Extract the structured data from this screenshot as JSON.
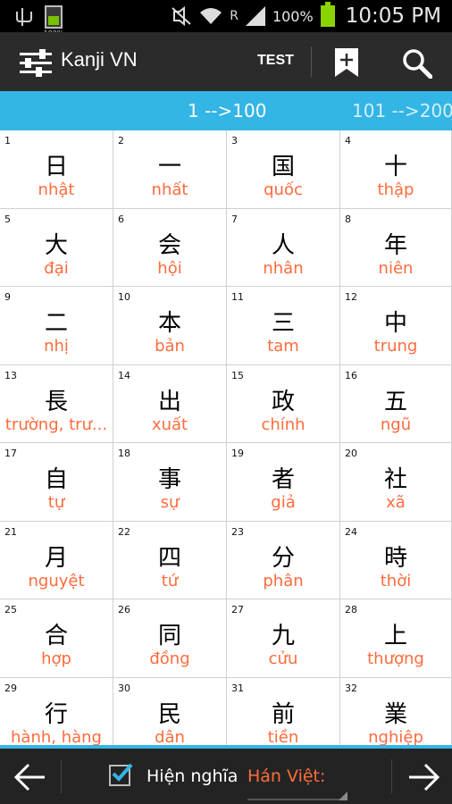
{
  "status_bar": {
    "mini_battery_percent": "100%",
    "roaming": "R",
    "battery_percent": "100%",
    "time": "10:05 PM"
  },
  "action_bar": {
    "title": "Kanji VN",
    "test_label": "TEST"
  },
  "tabs": [
    {
      "label": "1 -->100",
      "selected": true
    },
    {
      "label": "101 -->200",
      "selected": false
    }
  ],
  "kanji": [
    {
      "n": "1",
      "k": "日",
      "r": "nhật"
    },
    {
      "n": "2",
      "k": "一",
      "r": "nhất"
    },
    {
      "n": "3",
      "k": "国",
      "r": "quốc"
    },
    {
      "n": "4",
      "k": "十",
      "r": "thập"
    },
    {
      "n": "5",
      "k": "大",
      "r": "đại"
    },
    {
      "n": "6",
      "k": "会",
      "r": "hội"
    },
    {
      "n": "7",
      "k": "人",
      "r": "nhân"
    },
    {
      "n": "8",
      "k": "年",
      "r": "niên"
    },
    {
      "n": "9",
      "k": "二",
      "r": "nhị"
    },
    {
      "n": "10",
      "k": "本",
      "r": "bản"
    },
    {
      "n": "11",
      "k": "三",
      "r": "tam"
    },
    {
      "n": "12",
      "k": "中",
      "r": "trung"
    },
    {
      "n": "13",
      "k": "長",
      "r": "trường, trư..."
    },
    {
      "n": "14",
      "k": "出",
      "r": "xuất"
    },
    {
      "n": "15",
      "k": "政",
      "r": "chính"
    },
    {
      "n": "16",
      "k": "五",
      "r": "ngũ"
    },
    {
      "n": "17",
      "k": "自",
      "r": "tự"
    },
    {
      "n": "18",
      "k": "事",
      "r": "sự"
    },
    {
      "n": "19",
      "k": "者",
      "r": "giả"
    },
    {
      "n": "20",
      "k": "社",
      "r": "xã"
    },
    {
      "n": "21",
      "k": "月",
      "r": "nguyệt"
    },
    {
      "n": "22",
      "k": "四",
      "r": "tứ"
    },
    {
      "n": "23",
      "k": "分",
      "r": "phân"
    },
    {
      "n": "24",
      "k": "時",
      "r": "thời"
    },
    {
      "n": "25",
      "k": "合",
      "r": "hợp"
    },
    {
      "n": "26",
      "k": "同",
      "r": "đồng"
    },
    {
      "n": "27",
      "k": "九",
      "r": "cửu"
    },
    {
      "n": "28",
      "k": "上",
      "r": "thượng"
    },
    {
      "n": "29",
      "k": "行",
      "r": "hành, hàng"
    },
    {
      "n": "30",
      "k": "民",
      "r": "dân"
    },
    {
      "n": "31",
      "k": "前",
      "r": "tiền"
    },
    {
      "n": "32",
      "k": "業",
      "r": "nghiệp"
    }
  ],
  "bottom_bar": {
    "show_meaning_label": "Hiện nghĩa",
    "checked": true,
    "meaning_type": "Hán Việt:"
  },
  "colors": {
    "accent": "#33b5e5",
    "reading": "#ff6b3c",
    "actionbar": "#2b2b2b"
  }
}
